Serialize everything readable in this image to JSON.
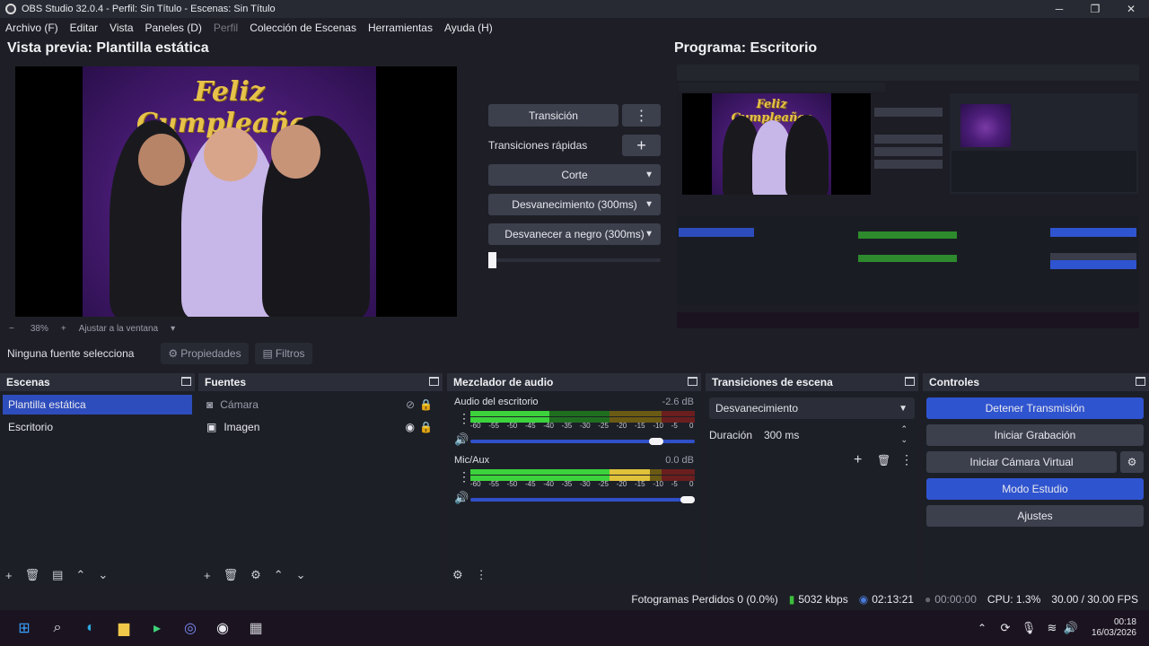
{
  "window": {
    "title": "OBS Studio 32.0.4 - Perfil: Sin Título - Escenas: Sin Título"
  },
  "menu": [
    "Archivo (F)",
    "Editar",
    "Vista",
    "Paneles (D)",
    "Perfil",
    "Colección de Escenas",
    "Herramientas",
    "Ayuda (H)"
  ],
  "preview": {
    "title": "Vista previa: Plantilla estática",
    "banner": "Feliz Cumpleaños",
    "zoom": "38%",
    "zoom_plus": "+",
    "zoom_minus": "−",
    "fit_label": "Ajustar a la ventana"
  },
  "program": {
    "title": "Programa: Escritorio"
  },
  "transitions_mid": {
    "transition_button": "Transición",
    "quick_transitions_label": "Transiciones rápidas",
    "quick_items": [
      "Corte",
      "Desvanecimiento (300ms)",
      "Desvanecer a negro (300ms)"
    ]
  },
  "source_bar": {
    "no_source": "Ninguna fuente selecciona",
    "properties": "Propiedades",
    "filters": "Filtros"
  },
  "scenes": {
    "title": "Escenas",
    "items": [
      "Plantilla estática",
      "Escritorio"
    ],
    "selected": 0
  },
  "sources": {
    "title": "Fuentes",
    "items": [
      {
        "name": "Cámara",
        "visible": false
      },
      {
        "name": "Imagen",
        "visible": true
      }
    ]
  },
  "mixer": {
    "title": "Mezclador de audio",
    "channels": [
      {
        "name": "Audio del escritorio",
        "db": "-2.6 dB",
        "volume": 0.85,
        "level": 0.35
      },
      {
        "name": "Mic/Aux",
        "db": "0.0 dB",
        "volume": 1.0,
        "level": 0.8
      }
    ],
    "ticks": [
      "-60",
      "-55",
      "-50",
      "-45",
      "-40",
      "-35",
      "-30",
      "-25",
      "-20",
      "-15",
      "-10",
      "-5",
      "0"
    ]
  },
  "scene_transitions": {
    "title": "Transiciones de escena",
    "selected": "Desvanecimiento",
    "duration_label": "Duración",
    "duration_value": "300 ms"
  },
  "controls": {
    "title": "Controles",
    "buttons": [
      "Detener Transmisión",
      "Iniciar Grabación",
      "Iniciar Cámara Virtual",
      "Modo Estudio",
      "Ajustes"
    ]
  },
  "status": {
    "dropped": "Fotogramas Perdidos 0 (0.0%)",
    "bitrate": "5032 kbps",
    "stream_time": "02:13:21",
    "rec_time": "00:00:00",
    "cpu": "CPU: 1.3%",
    "fps": "30.00 / 30.00 FPS"
  },
  "taskbar": {
    "time": "00:18",
    "date": "16/03/2026"
  },
  "colors": {
    "accent": "#2f54cf",
    "panel": "#1d1f27",
    "header": "#2b2e38",
    "button": "#3c404d"
  }
}
